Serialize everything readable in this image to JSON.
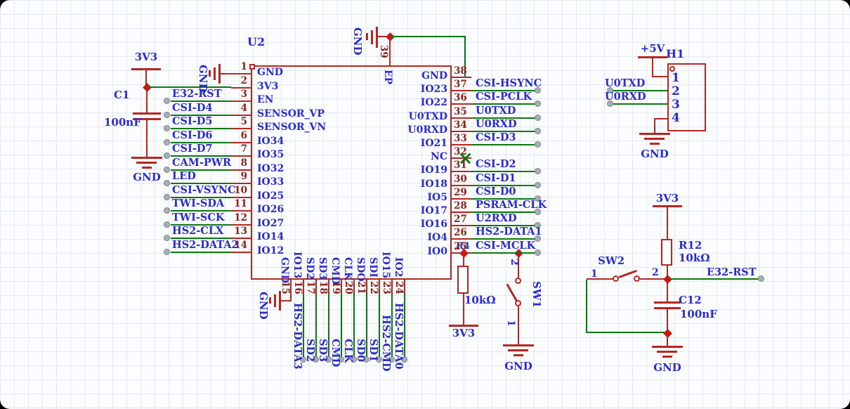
{
  "ic": {
    "ref": "U2",
    "top_pin": {
      "num": "39",
      "name": "EP",
      "gnd": "GND"
    },
    "left_pins": [
      {
        "num": "1",
        "name": "GND",
        "net": ""
      },
      {
        "num": "2",
        "name": "3V3",
        "net": ""
      },
      {
        "num": "3",
        "name": "EN",
        "net": "E32-RST"
      },
      {
        "num": "4",
        "name": "SENSOR_VP",
        "net": "CSI-D4"
      },
      {
        "num": "5",
        "name": "SENSOR_VN",
        "net": "CSI-D5"
      },
      {
        "num": "6",
        "name": "IO34",
        "net": "CSI-D6"
      },
      {
        "num": "7",
        "name": "IO35",
        "net": "CSI-D7"
      },
      {
        "num": "8",
        "name": "IO32",
        "net": "CAM-PWR"
      },
      {
        "num": "9",
        "name": "IO33",
        "net": "LED"
      },
      {
        "num": "10",
        "name": "IO25",
        "net": "CSI-VSYNC"
      },
      {
        "num": "11",
        "name": "IO26",
        "net": "TWI-SDA"
      },
      {
        "num": "12",
        "name": "IO27",
        "net": "TWI-SCK"
      },
      {
        "num": "13",
        "name": "IO14",
        "net": "HS2-CLX"
      },
      {
        "num": "14",
        "name": "IO12",
        "net": "HS2-DATA2"
      }
    ],
    "right_pins": [
      {
        "num": "38",
        "name": "GND",
        "net": ""
      },
      {
        "num": "37",
        "name": "IO23",
        "net": "CSI-HSYNC"
      },
      {
        "num": "36",
        "name": "IO22",
        "net": "CSI-PCLK"
      },
      {
        "num": "35",
        "name": "U0TXD",
        "net": "U0TXD"
      },
      {
        "num": "34",
        "name": "U0RXD",
        "net": "U0RXD"
      },
      {
        "num": "33",
        "name": "IO21",
        "net": "CSI-D3"
      },
      {
        "num": "32",
        "name": "NC",
        "net": "",
        "nc": true
      },
      {
        "num": "31",
        "name": "IO19",
        "net": "CSI-D2"
      },
      {
        "num": "30",
        "name": "IO18",
        "net": "CSI-D1"
      },
      {
        "num": "29",
        "name": "IO5",
        "net": "CSI-D0"
      },
      {
        "num": "28",
        "name": "IO17",
        "net": "PSRAM-CLK"
      },
      {
        "num": "27",
        "name": "IO16",
        "net": "U2RXD"
      },
      {
        "num": "26",
        "name": "IO4",
        "net": "HS2-DATA1"
      },
      {
        "num": "25",
        "name": "IO0",
        "net": "CSI-MCLK"
      }
    ],
    "bottom_pins": [
      {
        "num": "15",
        "name": "GND",
        "net": ""
      },
      {
        "num": "16",
        "name": "IO13",
        "net": "HS2-DATA3"
      },
      {
        "num": "17",
        "name": "SD2",
        "net": "SD2"
      },
      {
        "num": "18",
        "name": "SD3",
        "net": "SD3"
      },
      {
        "num": "19",
        "name": "CMD",
        "net": "CMD"
      },
      {
        "num": "20",
        "name": "CLK",
        "net": "CLK"
      },
      {
        "num": "21",
        "name": "SDO",
        "net": "SD0"
      },
      {
        "num": "22",
        "name": "SDI",
        "net": "SD1"
      },
      {
        "num": "23",
        "name": "IO15",
        "net": "HS2-CMD"
      },
      {
        "num": "24",
        "name": "IO2",
        "net": "HS2-DATA0"
      }
    ]
  },
  "left_rail": {
    "power": "3V3",
    "cap_ref": "C1",
    "cap_value": "100nF",
    "gnd": "GND",
    "pin1_gnd": "GND",
    "pin15_gnd": "GND"
  },
  "header": {
    "ref": "H1",
    "power": "+5V",
    "gnd": "GND",
    "pins": [
      "1",
      "2",
      "3",
      "4"
    ],
    "pin2_net": "U0TXD",
    "pin3_net": "U0RXD"
  },
  "boot": {
    "resistor_ref": "R4",
    "resistor_value": "10kΩ",
    "rail": "3V3",
    "switch_ref": "SW1",
    "pin_top": "2",
    "pin_bottom": "1",
    "gnd": "GND"
  },
  "reset": {
    "rail": "3V3",
    "resistor_ref": "R12",
    "resistor_value": "10kΩ",
    "cap_ref": "C12",
    "cap_value": "100nF",
    "switch_ref": "SW2",
    "pin_left": "1",
    "pin_right": "2",
    "net": "E32-RST",
    "gnd": "GND"
  },
  "colors": {
    "component_red": "#b52721",
    "wire_green": "#0a7a0f",
    "text_blue": "#2a2cc9",
    "pin_number_maroon": "#8a2418",
    "junction_red": "#cf1212",
    "pad_grey": "#a8b0b6"
  }
}
